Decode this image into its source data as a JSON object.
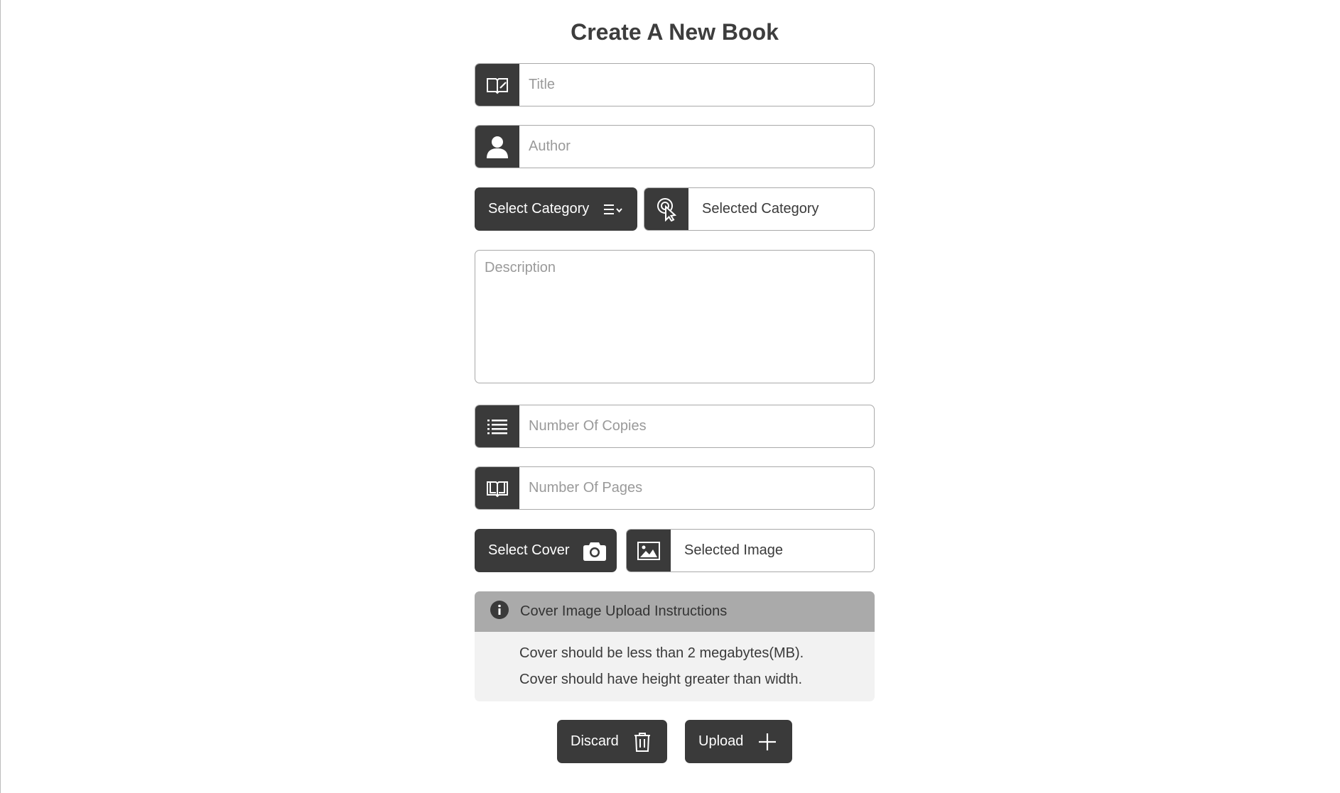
{
  "heading": "Create A New Book",
  "fields": {
    "title_placeholder": "Title",
    "author_placeholder": "Author",
    "description_placeholder": "Description",
    "copies_placeholder": "Number Of Copies",
    "pages_placeholder": "Number Of Pages"
  },
  "category": {
    "button_label": "Select Category",
    "selected_label": "Selected Category"
  },
  "cover": {
    "button_label": "Select Cover",
    "selected_label": "Selected Image"
  },
  "instructions": {
    "title": "Cover Image Upload Instructions",
    "lines": [
      "Cover should be less than 2 megabytes(MB).",
      "Cover should have height greater than width."
    ]
  },
  "actions": {
    "discard_label": "Discard",
    "upload_label": "Upload"
  },
  "colors": {
    "dark": "#3a3a3a",
    "info_header": "#aaaaaa",
    "info_body": "#f2f2f2"
  },
  "icons": {
    "title": "book-edit-icon",
    "author": "user-icon",
    "category_menu": "list-chevron-icon",
    "selected_category": "pointer-click-icon",
    "copies": "list-icon",
    "pages": "open-book-icon",
    "cover": "camera-icon",
    "selected_image": "image-icon",
    "info": "info-icon",
    "discard": "trash-icon",
    "upload": "plus-icon"
  }
}
